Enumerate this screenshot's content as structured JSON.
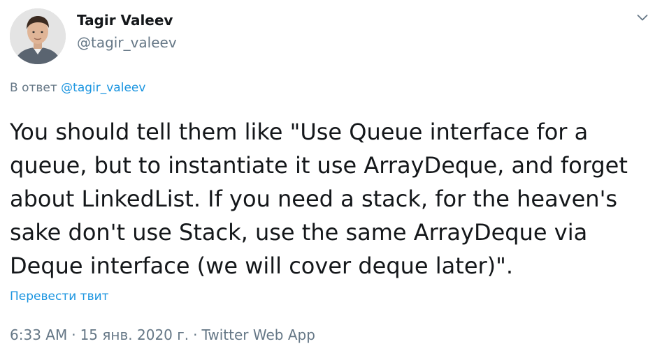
{
  "author": {
    "display_name": "Tagir Valeev",
    "handle": "@tagir_valeev"
  },
  "reply": {
    "prefix": "В ответ ",
    "mention": "@tagir_valeev"
  },
  "tweet": {
    "lines": [
      "You should tell them like \"Use Queue interface for a",
      "queue, but to instantiate it use ArrayDeque, and forget",
      "about LinkedList. If you need a stack, for the heaven's",
      "sake don't use Stack, use the same ArrayDeque via",
      "Deque interface (we will cover deque later)\"."
    ]
  },
  "translate_label": "Перевести твит",
  "meta": {
    "time": "6:33 AM",
    "separator": "·",
    "date": "15 янв. 2020 г.",
    "app": "Twitter Web App"
  },
  "icons": {
    "menu": "chevron-down-icon"
  },
  "colors": {
    "text": "#14171a",
    "secondary": "#657786",
    "link": "#1b95e0",
    "background": "#ffffff"
  }
}
